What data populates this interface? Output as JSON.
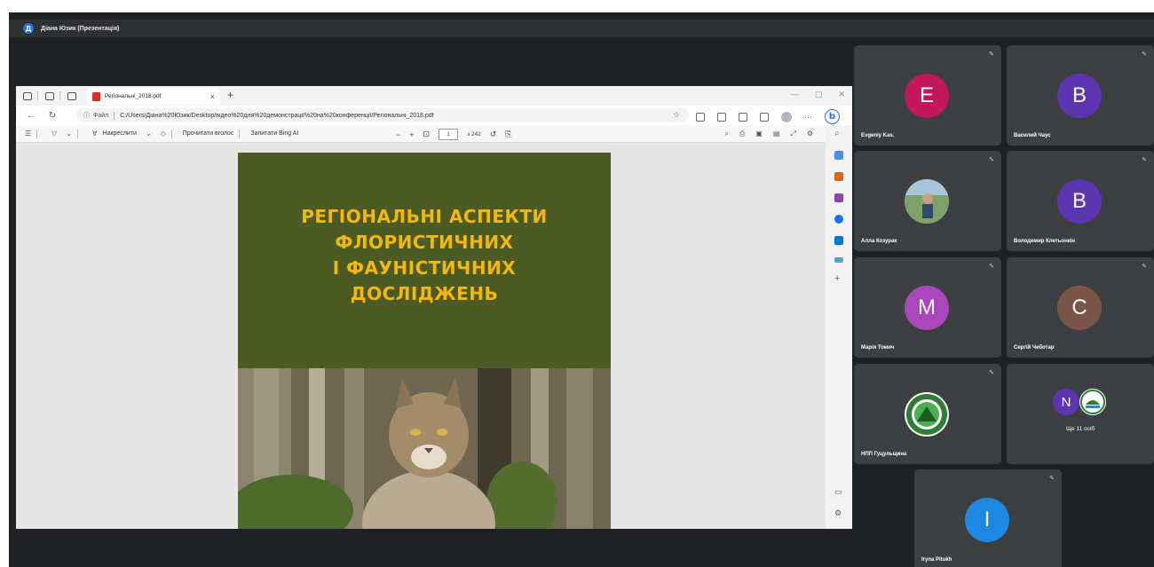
{
  "presenter": {
    "initial": "Д",
    "label": "Діана Юзик (Презентація)"
  },
  "browser": {
    "tab_title": "Регіональні_2018.pdf",
    "tab_close": "×",
    "new_tab": "+",
    "address": {
      "site_label": "Файл",
      "url": "C:/Users/Діана%20Юзик/Desktop/відео%20для%20демонстрації%20на%20конференції/Регіональні_2018.pdf"
    },
    "pdf_toolbar": {
      "draw_label": "Накреслити",
      "read_aloud_label": "Прочитати вголос",
      "ask_bing_label": "Запитати Bing AI",
      "zoom_out": "−",
      "zoom_in": "+",
      "page_current": "1",
      "page_total": "з 242"
    },
    "bing_button": "b"
  },
  "pdf": {
    "title_lines": [
      "РЕГІОНАЛЬНІ АСПЕКТИ",
      "ФЛОРИСТИЧНИХ",
      "І ФАУНІСТИЧНИХ",
      "ДОСЛІДЖЕНЬ"
    ]
  },
  "participants": [
    {
      "name": "Evgeniy Kas.",
      "initial": "E",
      "color": "#c2185b"
    },
    {
      "name": "Василий Чаус",
      "initial": "B",
      "color": "#5e35b1"
    },
    {
      "name": "Алла Козурак",
      "initial": "",
      "color": "#6d8f66"
    },
    {
      "name": "Володимир Клетьонкін",
      "initial": "B",
      "color": "#5e35b1"
    },
    {
      "name": "Марія Томич",
      "initial": "M",
      "color": "#ab47bc"
    },
    {
      "name": "Сергій Чеботар",
      "initial": "C",
      "color": "#795548"
    },
    {
      "name": "НПП Гуцульщина",
      "initial": "",
      "color": "#2e7d32"
    },
    {
      "name": "Iryna Pitukh",
      "initial": "I",
      "color": "#1e88e5"
    }
  ],
  "more_tile": {
    "initial": "N",
    "label": "Ще 11 осіб",
    "color": "#5e35b1"
  }
}
